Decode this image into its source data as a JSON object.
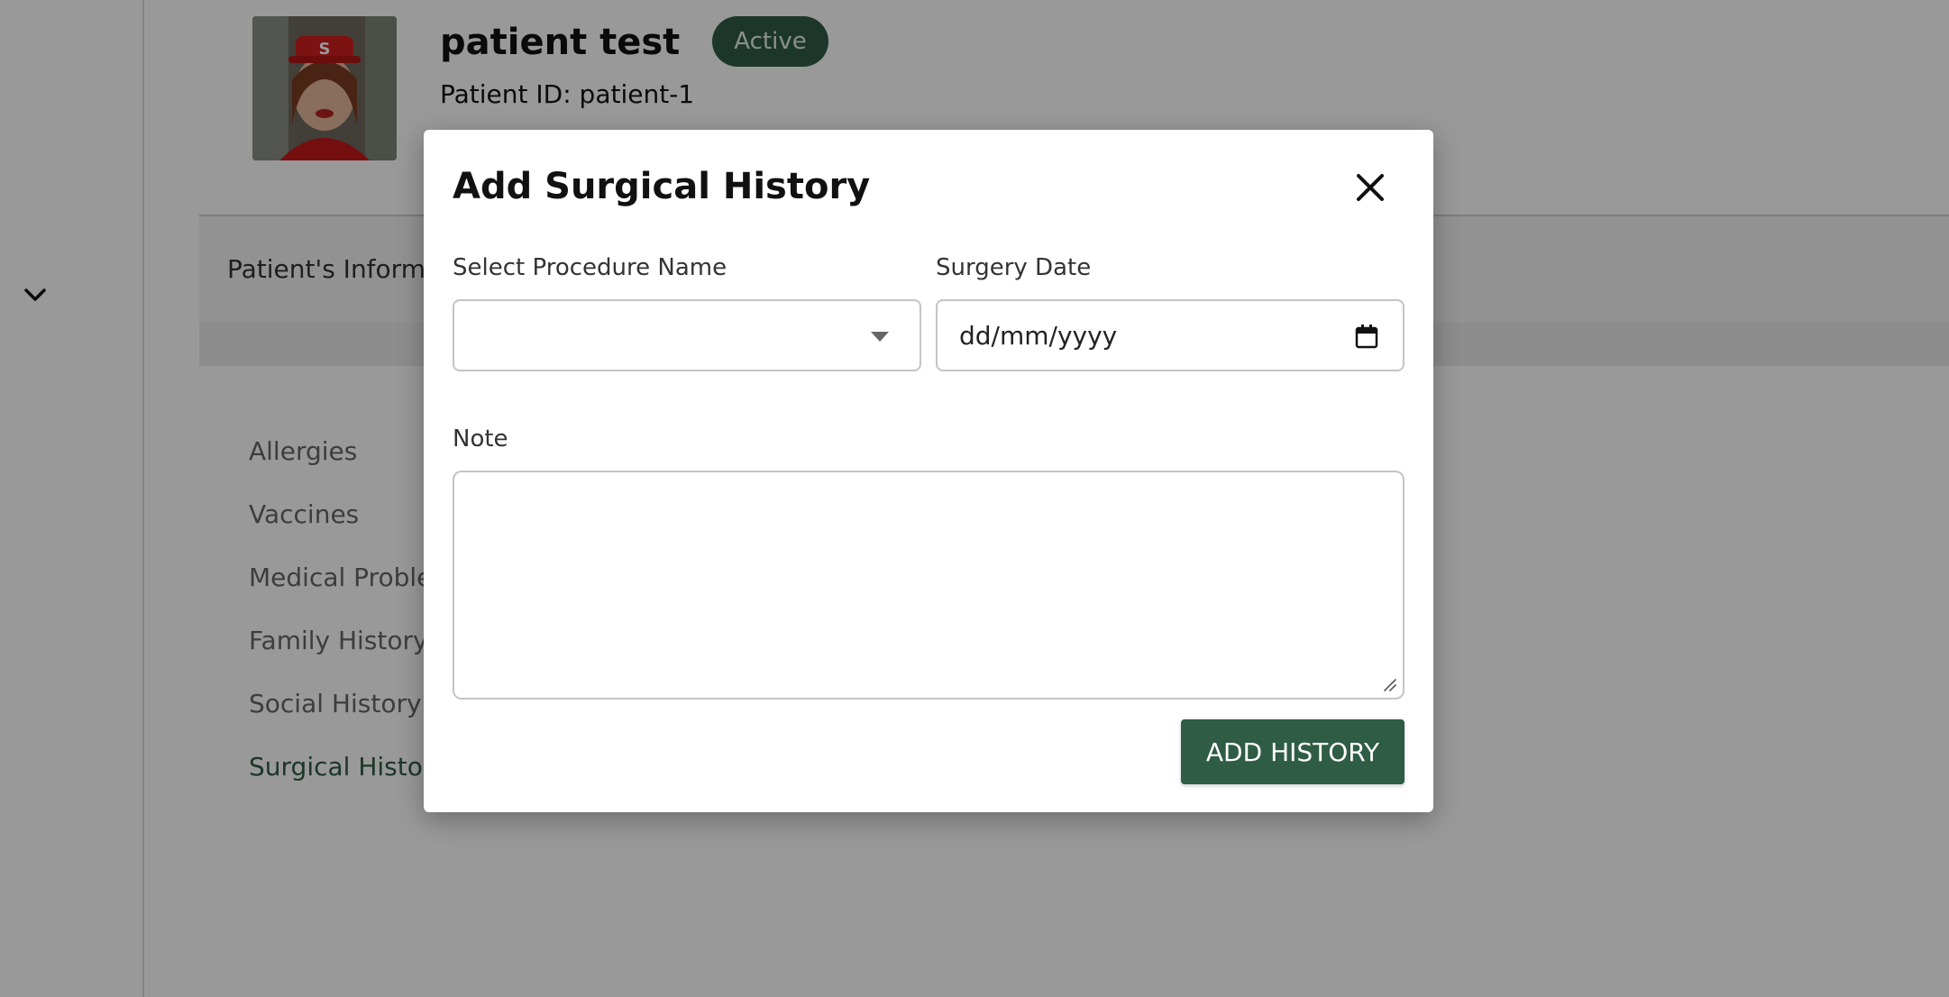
{
  "patient": {
    "name": "patient test",
    "status": "Active",
    "id_label": "Patient ID: patient-1"
  },
  "tabs": {
    "patient_info": "Patient's Informa"
  },
  "history_menu": {
    "items": [
      {
        "label": "Allergies"
      },
      {
        "label": "Vaccines"
      },
      {
        "label": "Medical Proble"
      },
      {
        "label": "Family History"
      },
      {
        "label": "Social History"
      },
      {
        "label": "Surgical History"
      }
    ],
    "active": "Surgical History"
  },
  "modal": {
    "title": "Add Surgical History",
    "procedure_label": "Select Procedure Name",
    "procedure_value": "",
    "surgery_date_label": "Surgery Date",
    "surgery_date_placeholder": "dd/mm/yyyy",
    "note_label": "Note",
    "note_value": "",
    "submit_label": "ADD HISTORY"
  },
  "colors": {
    "brand_green": "#2f5c45",
    "overlay": "rgba(0,0,0,0.4)"
  },
  "icons": {
    "close": "close-icon",
    "dropdown": "caret-down-icon",
    "calendar": "calendar-icon",
    "sidebar_toggle": "chevron-down-icon"
  }
}
